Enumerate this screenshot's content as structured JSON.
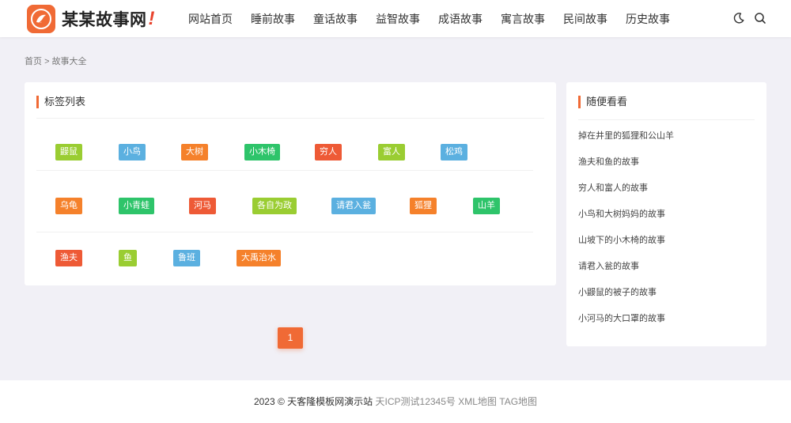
{
  "header": {
    "logo_text": "某某故事网",
    "logo_excl": "!",
    "nav": [
      "网站首页",
      "睡前故事",
      "童话故事",
      "益智故事",
      "成语故事",
      "寓言故事",
      "民间故事",
      "历史故事"
    ],
    "icons": [
      "moon-icon",
      "search-icon"
    ]
  },
  "breadcrumb": {
    "home": "首页",
    "sep": ">",
    "current": "故事大全"
  },
  "tags_panel": {
    "title": "标签列表",
    "rows": [
      [
        {
          "label": "鼹鼠",
          "color": "#9acd32"
        },
        {
          "label": "小鸟",
          "color": "#5bb0e0"
        },
        {
          "label": "大树",
          "color": "#f5812b"
        },
        {
          "label": "小木椅",
          "color": "#2ec46a"
        },
        {
          "label": "穷人",
          "color": "#ee5a36"
        },
        {
          "label": "富人",
          "color": "#9acd32"
        },
        {
          "label": "松鸡",
          "color": "#5bb0e0"
        }
      ],
      [
        {
          "label": "乌龟",
          "color": "#f5812b"
        },
        {
          "label": "小青蛙",
          "color": "#2ec46a"
        },
        {
          "label": "河马",
          "color": "#ee5a36"
        },
        {
          "label": "各自为政",
          "color": "#9acd32"
        },
        {
          "label": "请君入瓮",
          "color": "#5bb0e0"
        },
        {
          "label": "狐狸",
          "color": "#f5812b"
        },
        {
          "label": "山羊",
          "color": "#2ec46a"
        }
      ],
      [
        {
          "label": "渔夫",
          "color": "#ee5a36"
        },
        {
          "label": "鱼",
          "color": "#9acd32"
        },
        {
          "label": "鲁班",
          "color": "#5bb0e0"
        },
        {
          "label": "大禹治水",
          "color": "#f5812b"
        }
      ]
    ]
  },
  "pagination": {
    "current": "1"
  },
  "sidebar": {
    "title": "随便看看",
    "items": [
      "掉在井里的狐狸和公山羊",
      "渔夫和鱼的故事",
      "穷人和富人的故事",
      "小鸟和大树妈妈的故事",
      "山坡下的小木椅的故事",
      "请君入瓮的故事",
      "小鼹鼠的被子的故事",
      "小河马的大口罩的故事"
    ]
  },
  "footer": {
    "copyright": "2023 © 天客隆模板网演示站",
    "icp": "天ICP测试12345号",
    "xml_map": "XML地图",
    "tag_map": "TAG地图"
  },
  "colors": {
    "accent": "#f06a35",
    "bg": "#f1f0f6"
  }
}
